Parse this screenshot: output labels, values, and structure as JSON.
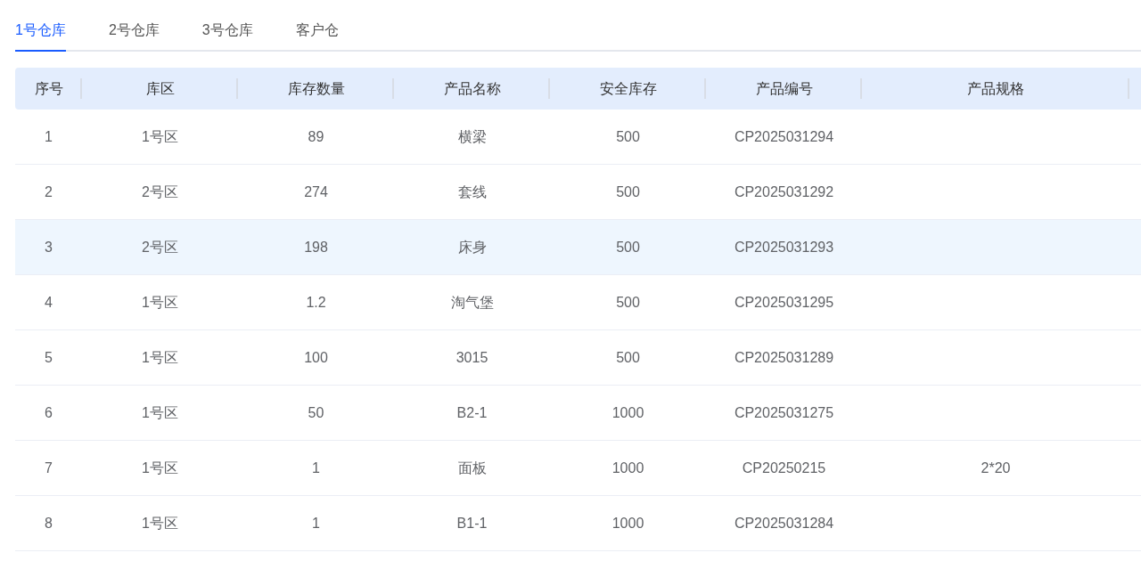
{
  "tabs": [
    {
      "label": "1号仓库",
      "selected": true
    },
    {
      "label": "2号仓库",
      "selected": false
    },
    {
      "label": "3号仓库",
      "selected": false
    },
    {
      "label": "客户仓",
      "selected": false
    }
  ],
  "table": {
    "columns": [
      "序号",
      "库区",
      "库存数量",
      "产品名称",
      "安全库存",
      "产品编号",
      "产品规格"
    ],
    "rows": [
      {
        "cells": [
          "1",
          "1号区",
          "89",
          "横梁",
          "500",
          "CP2025031294",
          ""
        ],
        "selected": false
      },
      {
        "cells": [
          "2",
          "2号区",
          "274",
          "套线",
          "500",
          "CP2025031292",
          ""
        ],
        "selected": false
      },
      {
        "cells": [
          "3",
          "2号区",
          "198",
          "床身",
          "500",
          "CP2025031293",
          ""
        ],
        "selected": true
      },
      {
        "cells": [
          "4",
          "1号区",
          "1.2",
          "淘气堡",
          "500",
          "CP2025031295",
          ""
        ],
        "selected": false
      },
      {
        "cells": [
          "5",
          "1号区",
          "100",
          "3015",
          "500",
          "CP2025031289",
          ""
        ],
        "selected": false
      },
      {
        "cells": [
          "6",
          "1号区",
          "50",
          "B2-1",
          "1000",
          "CP2025031275",
          ""
        ],
        "selected": false
      },
      {
        "cells": [
          "7",
          "1号区",
          "1",
          "面板",
          "1000",
          "CP20250215",
          "2*20"
        ],
        "selected": false
      },
      {
        "cells": [
          "8",
          "1号区",
          "1",
          "B1-1",
          "1000",
          "CP2025031284",
          ""
        ],
        "selected": false
      }
    ]
  }
}
